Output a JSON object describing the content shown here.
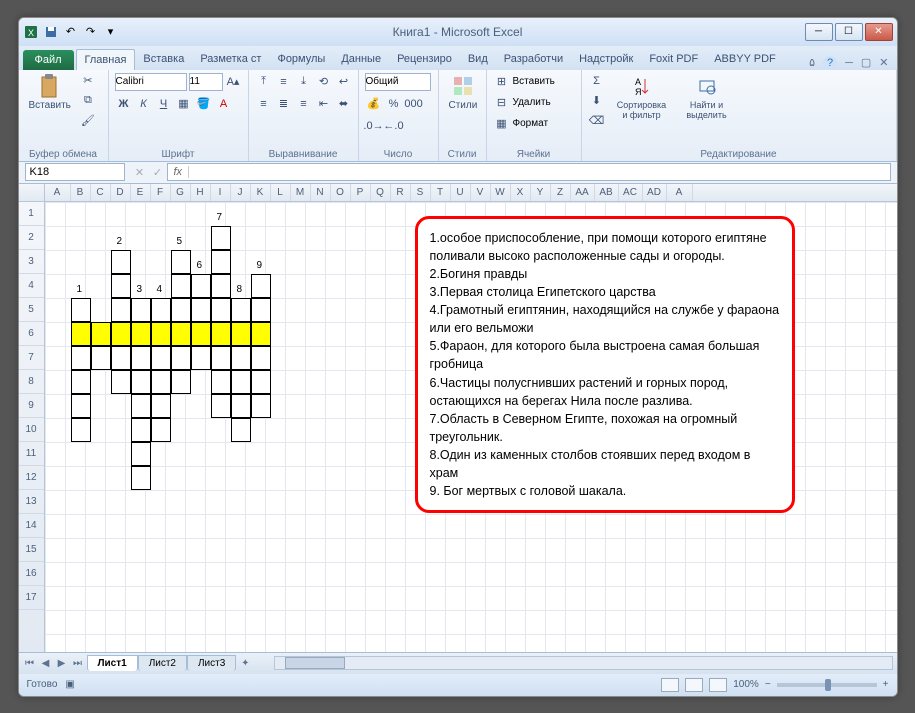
{
  "window": {
    "title": "Книга1 - Microsoft Excel"
  },
  "ribbon": {
    "file": "Файл",
    "tabs": [
      "Главная",
      "Вставка",
      "Разметка ст",
      "Формулы",
      "Данные",
      "Рецензиро",
      "Вид",
      "Разработчи",
      "Надстройк",
      "Foxit PDF",
      "ABBYY PDF"
    ],
    "active_tab": 0,
    "groups": {
      "clipboard": "Буфер обмена",
      "font": "Шрифт",
      "alignment": "Выравнивание",
      "number": "Число",
      "styles": "Стили",
      "cells": "Ячейки",
      "editing": "Редактирование"
    },
    "paste": "Вставить",
    "font_name": "Calibri",
    "font_size": "11",
    "number_format": "Общий",
    "styles_btn": "Стили",
    "insert": "Вставить",
    "delete": "Удалить",
    "format": "Формат",
    "sort_filter": "Сортировка и фильтр",
    "find_select": "Найти и выделить"
  },
  "namebox": "K18",
  "sheets": [
    "Лист1",
    "Лист2",
    "Лист3"
  ],
  "active_sheet": 0,
  "status": "Готово",
  "zoom": "100%",
  "columns": [
    "A",
    "B",
    "C",
    "D",
    "E",
    "F",
    "G",
    "H",
    "I",
    "J",
    "K",
    "L",
    "M",
    "N",
    "O",
    "P",
    "Q",
    "R",
    "S",
    "T",
    "U",
    "V",
    "W",
    "X",
    "Y",
    "Z",
    "AA",
    "AB",
    "AC",
    "AD",
    "A"
  ],
  "row_count": 17,
  "crossword": {
    "numbers": [
      {
        "n": "7",
        "col": "I",
        "row": 2
      },
      {
        "n": "2",
        "col": "D",
        "row": 3
      },
      {
        "n": "5",
        "col": "G",
        "row": 3
      },
      {
        "n": "6",
        "col": "H",
        "row": 4
      },
      {
        "n": "9",
        "col": "K",
        "row": 4
      },
      {
        "n": "1",
        "col": "B",
        "row": 5
      },
      {
        "n": "3",
        "col": "E",
        "row": 5
      },
      {
        "n": "4",
        "col": "F",
        "row": 5
      },
      {
        "n": "8",
        "col": "J",
        "row": 5
      }
    ],
    "cells": [
      {
        "col": "I",
        "row": 2
      },
      {
        "col": "D",
        "row": 3
      },
      {
        "col": "G",
        "row": 3
      },
      {
        "col": "I",
        "row": 3
      },
      {
        "col": "D",
        "row": 4
      },
      {
        "col": "G",
        "row": 4
      },
      {
        "col": "H",
        "row": 4
      },
      {
        "col": "I",
        "row": 4
      },
      {
        "col": "K",
        "row": 4
      },
      {
        "col": "B",
        "row": 5
      },
      {
        "col": "D",
        "row": 5
      },
      {
        "col": "E",
        "row": 5
      },
      {
        "col": "F",
        "row": 5
      },
      {
        "col": "G",
        "row": 5
      },
      {
        "col": "H",
        "row": 5
      },
      {
        "col": "I",
        "row": 5
      },
      {
        "col": "J",
        "row": 5
      },
      {
        "col": "K",
        "row": 5
      },
      {
        "col": "B",
        "row": 6,
        "y": true
      },
      {
        "col": "C",
        "row": 6,
        "y": true
      },
      {
        "col": "D",
        "row": 6,
        "y": true
      },
      {
        "col": "E",
        "row": 6,
        "y": true
      },
      {
        "col": "F",
        "row": 6,
        "y": true
      },
      {
        "col": "G",
        "row": 6,
        "y": true
      },
      {
        "col": "H",
        "row": 6,
        "y": true
      },
      {
        "col": "I",
        "row": 6,
        "y": true
      },
      {
        "col": "J",
        "row": 6,
        "y": true
      },
      {
        "col": "K",
        "row": 6,
        "y": true
      },
      {
        "col": "B",
        "row": 7
      },
      {
        "col": "C",
        "row": 7
      },
      {
        "col": "D",
        "row": 7
      },
      {
        "col": "E",
        "row": 7
      },
      {
        "col": "F",
        "row": 7
      },
      {
        "col": "G",
        "row": 7
      },
      {
        "col": "H",
        "row": 7
      },
      {
        "col": "I",
        "row": 7
      },
      {
        "col": "J",
        "row": 7
      },
      {
        "col": "K",
        "row": 7
      },
      {
        "col": "B",
        "row": 8
      },
      {
        "col": "D",
        "row": 8
      },
      {
        "col": "E",
        "row": 8
      },
      {
        "col": "F",
        "row": 8
      },
      {
        "col": "G",
        "row": 8
      },
      {
        "col": "I",
        "row": 8
      },
      {
        "col": "J",
        "row": 8
      },
      {
        "col": "K",
        "row": 8
      },
      {
        "col": "B",
        "row": 9
      },
      {
        "col": "E",
        "row": 9
      },
      {
        "col": "F",
        "row": 9
      },
      {
        "col": "I",
        "row": 9
      },
      {
        "col": "J",
        "row": 9
      },
      {
        "col": "K",
        "row": 9
      },
      {
        "col": "B",
        "row": 10
      },
      {
        "col": "E",
        "row": 10
      },
      {
        "col": "F",
        "row": 10
      },
      {
        "col": "J",
        "row": 10
      },
      {
        "col": "E",
        "row": 11
      },
      {
        "col": "E",
        "row": 12
      }
    ]
  },
  "clues": [
    "1.особое приспособление, при помощи которого египтяне поливали высоко расположенные сады и огороды.",
    "2.Богиня правды",
    "3.Первая столица Египетского царства",
    "4.Грамотный египтянин, находящийся на службе у фараона или его вельможи",
    "5.Фараон, для которого была выстроена самая большая гробница",
    "6.Частицы полусгнивших растений и горных пород, остающихся на берегах Нила после разлива.",
    "7.Область в Северном Египте, похожая на огромный треугольник.",
    "8.Один из каменных столбов стоявших перед входом в храм",
    "9. Бог мертвых с головой шакала."
  ]
}
